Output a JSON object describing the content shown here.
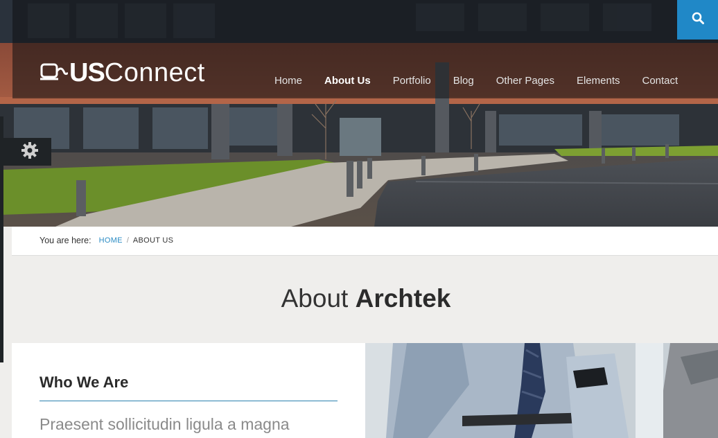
{
  "header": {
    "logo_us": "US",
    "logo_connect": "Connect",
    "nav": [
      "Home",
      "About Us",
      "Portfolio",
      "Blog",
      "Other Pages",
      "Elements",
      "Contact"
    ],
    "active_nav": "About Us"
  },
  "icons": {
    "search": "search-icon",
    "settings": "gear-icon",
    "logo": "laptop-icon"
  },
  "breadcrumb": {
    "label": "You are here:",
    "home": "HOME",
    "separator": "/",
    "current": "ABOUT US"
  },
  "page": {
    "title_light": "About",
    "title_bold": "Archtek"
  },
  "section": {
    "heading": "Who We Are",
    "lead": "Praesent sollicitudin ligula a magna"
  },
  "colors": {
    "accent": "#2088c7",
    "dark": "#1f2326",
    "background": "#efeeec"
  }
}
